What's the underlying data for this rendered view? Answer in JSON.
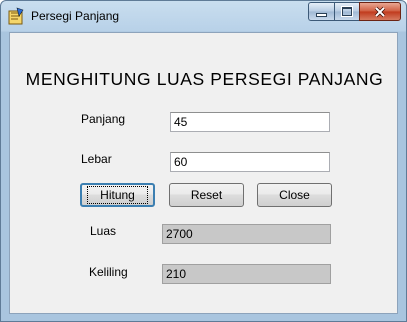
{
  "window": {
    "title": "Persegi Panjang",
    "controls": {
      "minimize": "▁",
      "maximize": "□",
      "close": "✕"
    }
  },
  "form": {
    "heading": "MENGHITUNG LUAS PERSEGI PANJANG",
    "panjang": {
      "label": "Panjang",
      "value": "45"
    },
    "lebar": {
      "label": "Lebar",
      "value": "60"
    },
    "buttons": {
      "hitung": "Hitung",
      "reset": "Reset",
      "close": "Close"
    },
    "luas": {
      "label": "Luas",
      "value": "2700"
    },
    "keliling": {
      "label": "Keliling",
      "value": "210"
    }
  },
  "icons": {
    "app": "vb-form-icon"
  }
}
